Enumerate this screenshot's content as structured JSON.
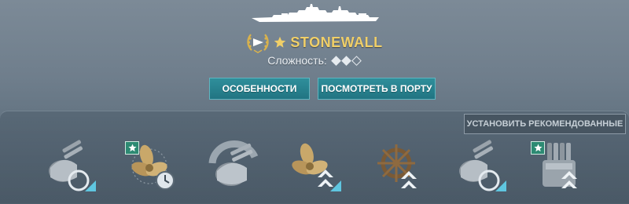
{
  "ship": {
    "name": "STONEWALL",
    "difficulty_label": "Сложность:",
    "difficulty": {
      "filled": 2,
      "total": 3
    }
  },
  "buttons": {
    "features_label": "ОСОБЕННОСТИ",
    "port_label": "ПОСМОТРЕТЬ В ПОРТУ",
    "recommended_label": "УСТАНОВИТЬ РЕКОМЕНДОВАННЫЕ"
  },
  "colors": {
    "name_gold": "#f0cf68",
    "button_teal": "#217482",
    "badge_green": "#2d8a73"
  },
  "upgrade_slots": [
    {
      "icon": "turret-reload-icon",
      "starred": false
    },
    {
      "icon": "propeller-timer-icon",
      "starred": true
    },
    {
      "icon": "turret-rotation-icon",
      "starred": false
    },
    {
      "icon": "propeller-upgrade-icon",
      "starred": false
    },
    {
      "icon": "ship-wheel-upgrade-icon",
      "starred": false
    },
    {
      "icon": "turret-reload-icon",
      "starred": false
    },
    {
      "icon": "torpedo-launcher-upgrade-icon",
      "starred": true
    }
  ]
}
